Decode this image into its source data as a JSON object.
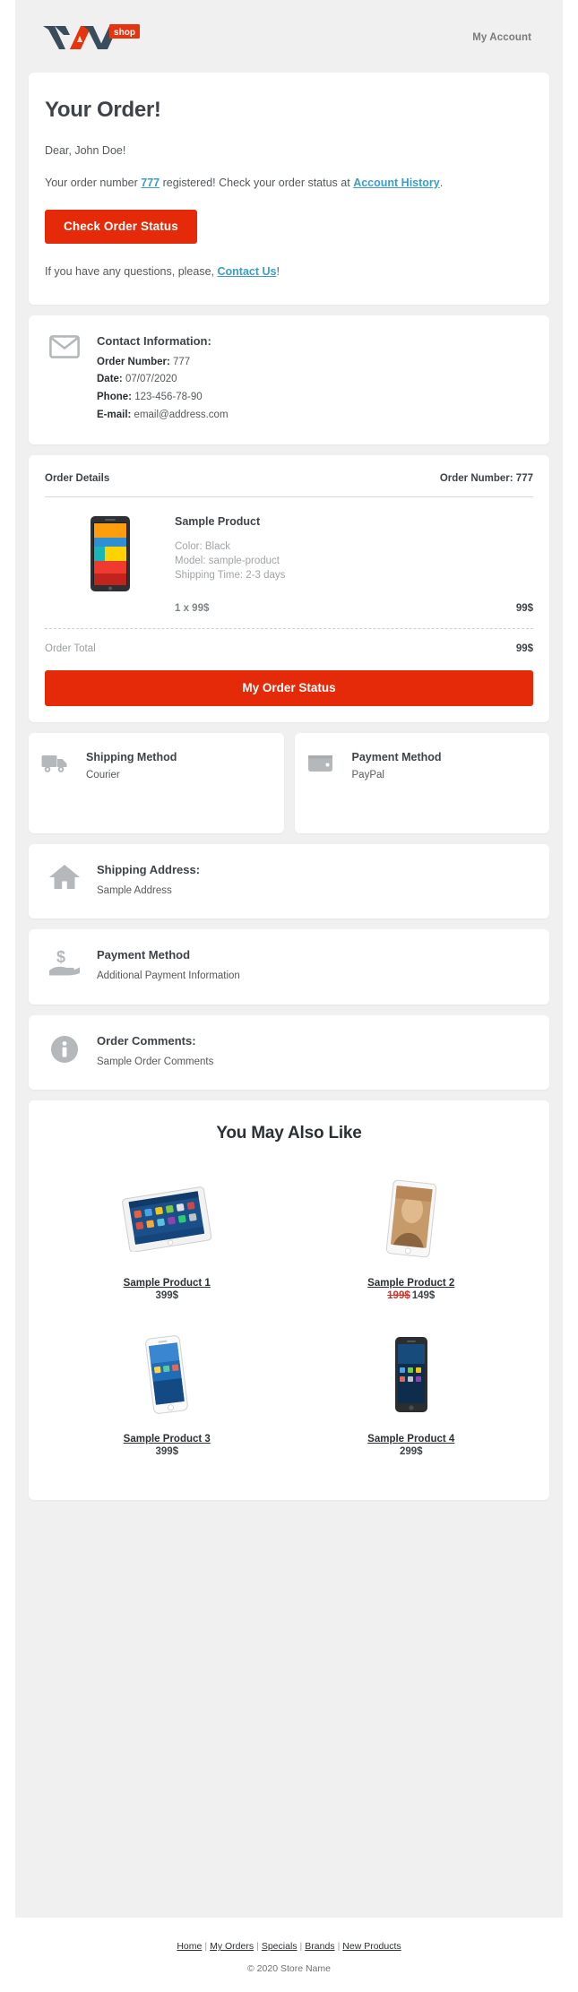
{
  "header": {
    "logo_text": "VAVA",
    "logo_badge": "shop",
    "my_account": "My Account"
  },
  "intro": {
    "title": "Your Order!",
    "greeting": "Dear, John Doe!",
    "order_line_pre": "Your order number ",
    "order_number_link": "777",
    "order_line_mid": " registered! Check your order status at ",
    "account_history_link": "Account History",
    "order_line_end": ".",
    "cta_label": "Check Order Status",
    "questions_pre": "If you have any questions, please, ",
    "contact_link": "Contact Us",
    "questions_end": "!"
  },
  "contact": {
    "icon": "envelope-icon",
    "title": "Contact Information:",
    "fields": [
      {
        "label": "Order Number:",
        "value": "777"
      },
      {
        "label": "Date:",
        "value": "07/07/2020"
      },
      {
        "label": "Phone:",
        "value": "123-456-78-90"
      },
      {
        "label": "E-mail:",
        "value": "email@address.com"
      }
    ]
  },
  "order_details": {
    "heading": "Order Details",
    "order_number_label": "Order Number: 777",
    "product": {
      "name": "Sample Product",
      "color": "Color: Black",
      "model": "Model: sample-product",
      "shipping_time": "Shipping Time: 2-3 days",
      "qty_price": "1 x 99$",
      "line_total": "99$"
    },
    "total_label": "Order Total",
    "total_value": "99$",
    "status_button": "My Order Status"
  },
  "methods": {
    "shipping": {
      "icon": "truck-icon",
      "title": "Shipping Method",
      "value": "Courier"
    },
    "payment": {
      "icon": "wallet-icon",
      "title": "Payment Method",
      "value": "PayPal"
    }
  },
  "shipping_address": {
    "icon": "home-icon",
    "title": "Shipping Address:",
    "value": "Sample Address"
  },
  "payment_info": {
    "icon": "hand-dollar-icon",
    "title": "Payment Method",
    "value": "Additional Payment Information"
  },
  "comments": {
    "icon": "info-circle-icon",
    "title": "Order Comments:",
    "value": "Sample Order Comments"
  },
  "upsell": {
    "title": "You May Also Like",
    "products": [
      {
        "name": "Sample Product 1",
        "price": "399$",
        "old_price": "",
        "image": "tablet-white"
      },
      {
        "name": "Sample Product 2",
        "price": "149$",
        "old_price": "199$",
        "image": "tablet-gold"
      },
      {
        "name": "Sample Product 3",
        "price": "399$",
        "old_price": "",
        "image": "phone-white"
      },
      {
        "name": "Sample Product 4",
        "price": "299$",
        "old_price": "",
        "image": "phone-black"
      }
    ]
  },
  "footer": {
    "links": [
      "Home",
      "My Orders",
      "Specials",
      "Brands",
      "New Products"
    ],
    "separator": "|",
    "copyright": "© 2020 Store Name"
  },
  "colors": {
    "accent": "#e42a09",
    "link": "#3c9ec4",
    "sale": "#d0342c",
    "page_bg": "#f0f0f0"
  }
}
